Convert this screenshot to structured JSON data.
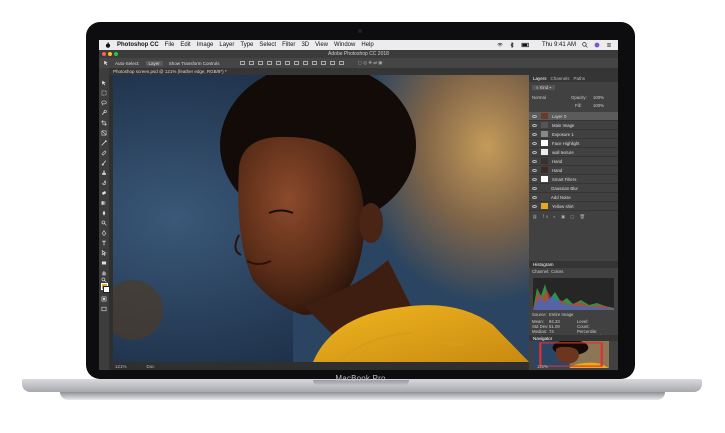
{
  "device": {
    "brand_label": "MacBook Pro"
  },
  "menubar": {
    "app_name": "Photoshop CC",
    "items": [
      "File",
      "Edit",
      "Image",
      "Layer",
      "Type",
      "Select",
      "Filter",
      "3D",
      "View",
      "Window",
      "Help"
    ],
    "clock": "Thu 9:41 AM"
  },
  "window": {
    "title": "Adobe Photoshop CC 2018"
  },
  "options_bar": {
    "auto_select_label": "Auto-Select:",
    "auto_select_value": "Layer",
    "transform_label": "Show Transform Controls"
  },
  "document": {
    "tab_label": "Photoshop screen.psd @ 121% (feather edge, RGB/8*) *"
  },
  "status": {
    "zoom": "121%",
    "doc_info": "Doc"
  },
  "panels": {
    "layers_tabs": [
      "Layers",
      "Channels",
      "Paths"
    ],
    "blend_mode": "Normal",
    "opacity_label": "Opacity:",
    "opacity_value": "100%",
    "fill_label": "Fill:",
    "fill_value": "100%",
    "layers": [
      "Layer 0",
      "Main Image",
      "Exposure 1",
      "Face Highlight",
      "wall texture",
      "Hand",
      "Hand",
      "Smart Filters",
      "Gaussian Blur",
      "Add Noise",
      "Yellow shirt"
    ],
    "histogram_title": "Histogram",
    "histogram_channel_label": "Channel:",
    "histogram_channel_value": "Colors",
    "histogram_source_label": "Source:",
    "histogram_source_value": "Entire Image",
    "stats_left": [
      "Mean:",
      "Std Dev:",
      "Median:",
      "Pixels:"
    ],
    "stats_left_values": [
      "84.33",
      "51.09",
      "74",
      "307200"
    ],
    "stats_right": [
      "Level:",
      "Count:",
      "Percentile:",
      "Cache Level:"
    ],
    "stats_right_values": [
      "",
      "",
      "",
      "1"
    ],
    "navigator_title": "Navigator",
    "navigator_zoom": "121%"
  }
}
